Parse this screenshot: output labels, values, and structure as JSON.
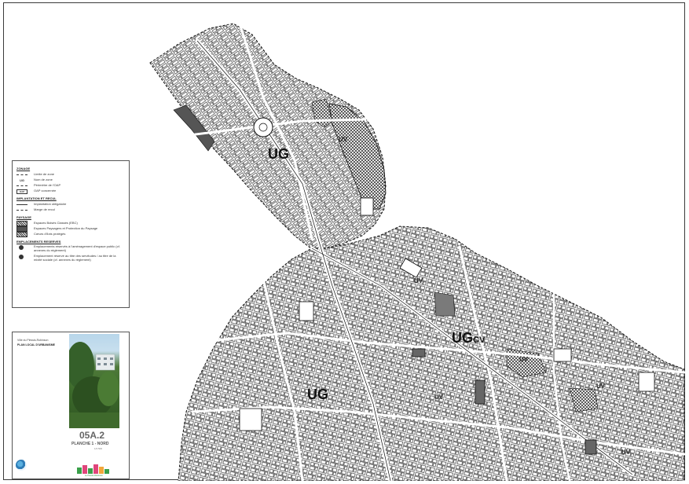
{
  "map": {
    "zones": [
      {
        "code": "UG",
        "sub": ""
      },
      {
        "code": "UG",
        "sub": "CV"
      },
      {
        "code": "UG",
        "sub": ""
      }
    ],
    "small_labels": [
      "UV",
      "UV",
      "UV",
      "UV",
      "UV",
      "UV"
    ],
    "colors": {
      "ink": "#111111",
      "hatch": "#333333",
      "paper": "#ffffff"
    }
  },
  "legend": {
    "sections": [
      {
        "title": "ZONAGE",
        "items": [
          {
            "symbol": "line-dash",
            "label": "Limite de zone"
          },
          {
            "symbol": "text",
            "symbol_text": "UG",
            "label": "Nom de zone"
          },
          {
            "symbol": "line-dash",
            "label": "Périmètre de l'OAP"
          },
          {
            "symbol": "box",
            "symbol_text": "OAP",
            "label": "OAP concernée"
          }
        ]
      },
      {
        "title": "IMPLANTATION ET RECUL",
        "items": [
          {
            "symbol": "line-solid",
            "label": "Implantation obligatoire"
          },
          {
            "symbol": "line-dash",
            "label": "Marge de recul"
          }
        ]
      },
      {
        "title": "PAYSAGE",
        "items": [
          {
            "symbol": "fill-hatch",
            "label": "Espaces Boisés Classés (EBC)"
          },
          {
            "symbol": "fill-dark",
            "label": "Espaces Paysagers et Protection du Paysage"
          },
          {
            "symbol": "fill-hatch",
            "label": "Cœurs d'îlots protégés"
          }
        ]
      },
      {
        "title": "EMPLACEMENTS RESERVES",
        "items": [
          {
            "symbol": "circle",
            "label": "Emplacements réservés à l'aménagement d'espace public (cf. annexes du règlement)"
          },
          {
            "symbol": "circle",
            "label": "Emplacement réservé au titre des servitudes / au titre de la mixité sociale (cf. annexes du règlement)"
          }
        ]
      }
    ]
  },
  "title_panel": {
    "city": "Ville du Plessis-Robinson",
    "plan": "PLAN LOCAL D'URBANISME",
    "code": "05A.2",
    "planche": "PLANCHE 1 - NORD",
    "scale": "1/3 500",
    "logo_caption": "Le Plessis-Robinson"
  }
}
